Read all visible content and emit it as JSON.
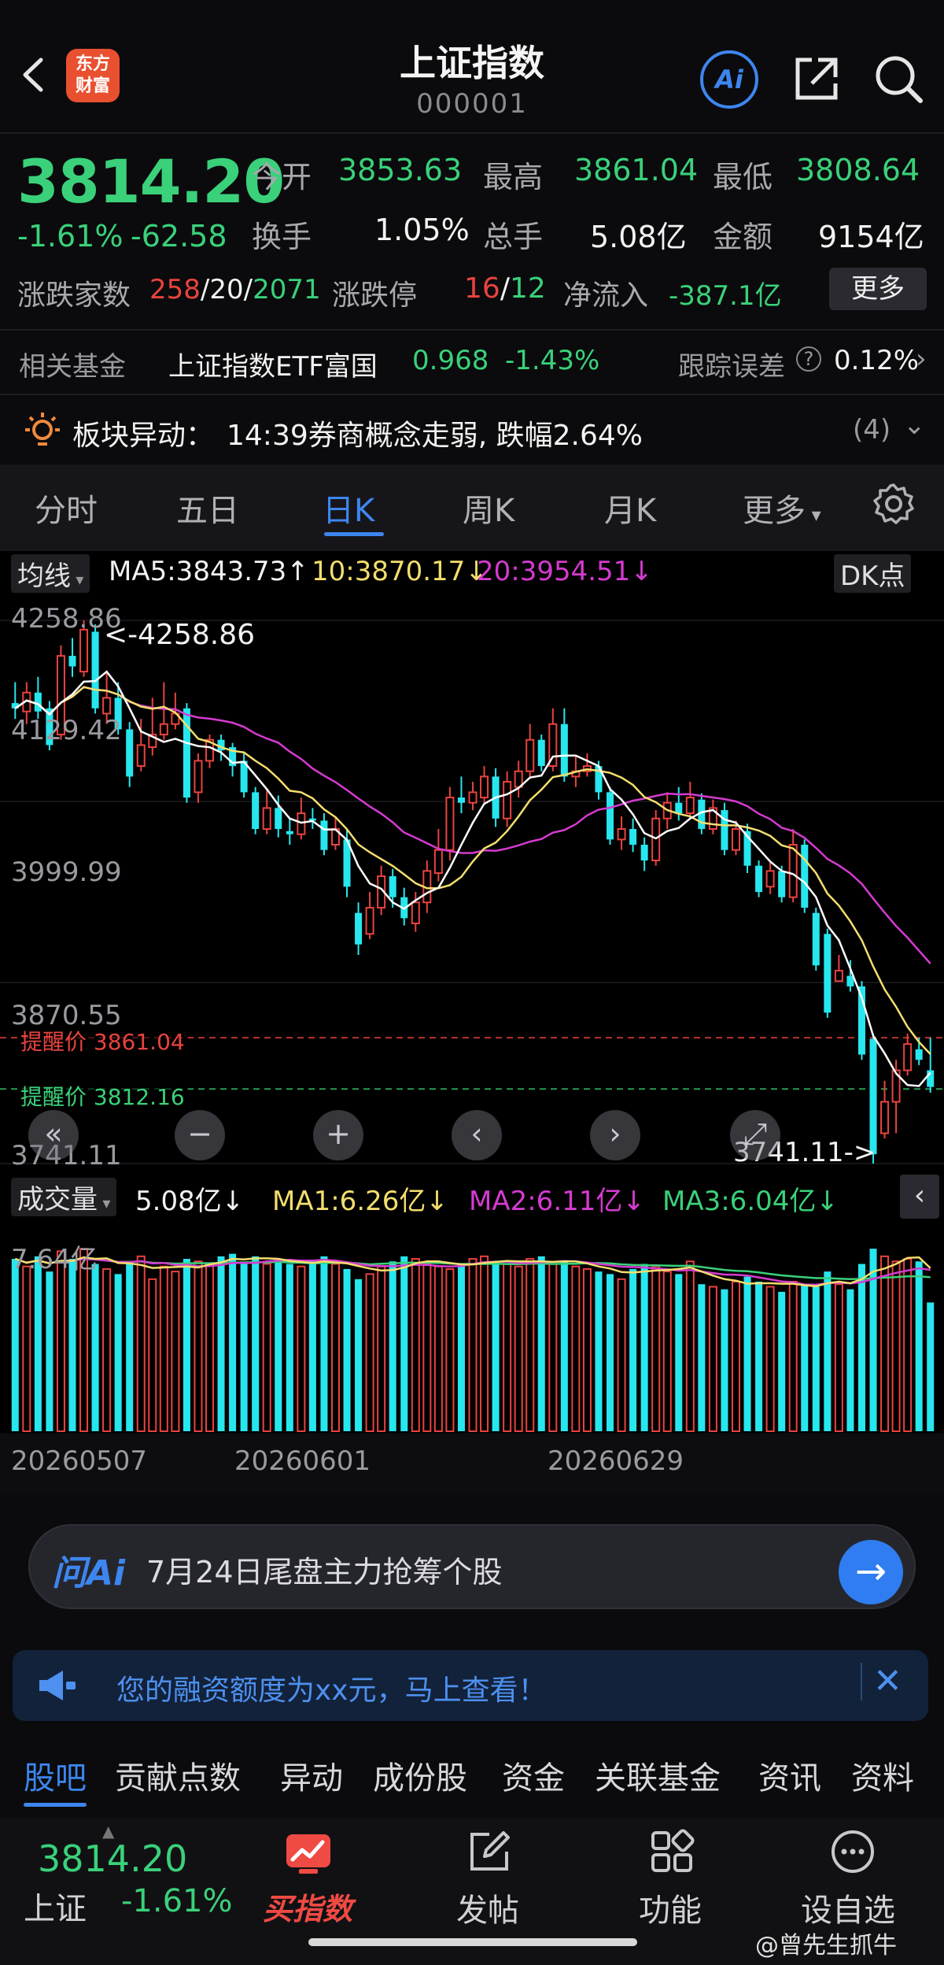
{
  "header": {
    "title": "上证指数",
    "code": "000001",
    "logo_text_1": "东方",
    "logo_text_2": "财富",
    "ai_label": "Ai"
  },
  "quote": {
    "price": "3814.20",
    "change_pct": "-1.61%",
    "change_abs": "-62.58",
    "open_label": "今开",
    "open": "3853.63",
    "high_label": "最高",
    "high": "3861.04",
    "low_label": "最低",
    "low": "3808.64",
    "turnover_label": "换手",
    "turnover": "1.05%",
    "volume_label": "总手",
    "volume": "5.08亿",
    "amount_label": "金额",
    "amount": "9154亿",
    "breadth_label": "涨跌家数",
    "up_count": "258",
    "flat_count": "20",
    "down_count": "2071",
    "limit_label": "涨跌停",
    "limit_up": "16",
    "limit_down": "12",
    "inflow_label": "净流入",
    "inflow": "-387.1亿",
    "more_label": "更多"
  },
  "fund": {
    "label": "相关基金",
    "name": "上证指数ETF富国",
    "price": "0.968",
    "change": "-1.43%",
    "tracking_label": "跟踪误差",
    "tracking_value": "0.12%"
  },
  "alert": {
    "label": "板块异动",
    "text": "14:39券商概念走弱, 跌幅2.64%",
    "count": "(4)"
  },
  "period_tabs": [
    "分时",
    "五日",
    "日K",
    "周K",
    "月K",
    "更多"
  ],
  "chart_header": {
    "indicator": "均线",
    "ma5": "MA5:3843.73",
    "ma10": "10:3870.17",
    "ma20": "20:3954.51",
    "dk_label": "DK点"
  },
  "price_axis": [
    "4258.86",
    "4129.42",
    "3999.99",
    "3870.55",
    "3741.11"
  ],
  "chart_annotations": {
    "max_label": "<-4258.86",
    "min_label": "3741.11->",
    "alert_red_label": "提醒价",
    "alert_red_value": "3861.04",
    "alert_green_label": "提醒价",
    "alert_green_value": "3812.16"
  },
  "volume_header": {
    "indicator": "成交量",
    "vol": "5.08亿",
    "ma1": "MA1:6.26亿",
    "ma2": "MA2:6.11亿",
    "ma3": "MA3:6.04亿",
    "axis_top": "7.64亿"
  },
  "date_axis": [
    "20260507",
    "20260601",
    "20260629"
  ],
  "ask": {
    "logo": "问Ai",
    "text": "7月24日尾盘主力抢筹个股"
  },
  "promo": {
    "text": "您的融资额度为xx元，马上查看！"
  },
  "bottom_tabs": [
    "股吧",
    "贡献点数",
    "异动",
    "成份股",
    "资金",
    "关联基金",
    "资讯",
    "资料"
  ],
  "bottom_bar": {
    "price": "3814.20",
    "name": "上证",
    "change": "-1.61%",
    "buy_label": "买指数",
    "post_label": "发帖",
    "func_label": "功能",
    "watch_label": "设自选"
  },
  "watermark": "@曾先生抓牛",
  "colors": {
    "up": "#e8433f",
    "down": "#27e6ee",
    "accent": "#3d86f0",
    "ma5": "#ffffff",
    "ma10": "#f3de6d",
    "ma20": "#d53bd0"
  },
  "chart_data": {
    "type": "candlestick",
    "price_range": [
      3741.11,
      4258.86
    ],
    "candles": [
      [
        4180,
        4175,
        4200,
        4165
      ],
      [
        4172,
        4190,
        4200,
        4160
      ],
      [
        4190,
        4172,
        4205,
        4165
      ],
      [
        4175,
        4140,
        4182,
        4135
      ],
      [
        4150,
        4225,
        4235,
        4145
      ],
      [
        4225,
        4215,
        4242,
        4205
      ],
      [
        4210,
        4250,
        4258.86,
        4205
      ],
      [
        4248,
        4175,
        4255,
        4170
      ],
      [
        4170,
        4185,
        4210,
        4160
      ],
      [
        4185,
        4155,
        4200,
        4150
      ],
      [
        4155,
        4110,
        4162,
        4100
      ],
      [
        4120,
        4140,
        4165,
        4115
      ],
      [
        4138,
        4150,
        4185,
        4130
      ],
      [
        4150,
        4160,
        4200,
        4145
      ],
      [
        4160,
        4170,
        4190,
        4155
      ],
      [
        4175,
        4090,
        4180,
        4085
      ],
      [
        4095,
        4125,
        4132,
        4085
      ],
      [
        4125,
        4145,
        4150,
        4118
      ],
      [
        4145,
        4135,
        4150,
        4125
      ],
      [
        4138,
        4120,
        4142,
        4110
      ],
      [
        4125,
        4095,
        4132,
        4090
      ],
      [
        4095,
        4060,
        4100,
        4055
      ],
      [
        4060,
        4080,
        4098,
        4055
      ],
      [
        4080,
        4060,
        4092,
        4052
      ],
      [
        4058,
        4055,
        4070,
        4045
      ],
      [
        4055,
        4075,
        4090,
        4050
      ],
      [
        4070,
        4068,
        4080,
        4060
      ],
      [
        4068,
        4040,
        4075,
        4035
      ],
      [
        4045,
        4060,
        4072,
        4040
      ],
      [
        4050,
        4005,
        4060,
        3995
      ],
      [
        3980,
        3950,
        3990,
        3940
      ],
      [
        3960,
        3985,
        4000,
        3955
      ],
      [
        3985,
        4015,
        4025,
        3978
      ],
      [
        4015,
        3995,
        4022,
        3985
      ],
      [
        3995,
        3975,
        4004,
        3968
      ],
      [
        3970,
        3990,
        4000,
        3962
      ],
      [
        3990,
        4020,
        4030,
        3980
      ],
      [
        4018,
        4040,
        4060,
        4010
      ],
      [
        4040,
        4090,
        4100,
        4030
      ],
      [
        4090,
        4085,
        4110,
        4075
      ],
      [
        4085,
        4095,
        4105,
        4078
      ],
      [
        4090,
        4110,
        4120,
        4085
      ],
      [
        4110,
        4070,
        4118,
        4062
      ],
      [
        4070,
        4105,
        4115,
        4062
      ],
      [
        4100,
        4115,
        4125,
        4090
      ],
      [
        4115,
        4145,
        4160,
        4108
      ],
      [
        4145,
        4120,
        4150,
        4115
      ],
      [
        4120,
        4160,
        4175,
        4115
      ],
      [
        4160,
        4110,
        4175,
        4105
      ],
      [
        4110,
        4115,
        4130,
        4100
      ],
      [
        4115,
        4120,
        4132,
        4110
      ],
      [
        4120,
        4095,
        4125,
        4088
      ],
      [
        4095,
        4050,
        4100,
        4045
      ],
      [
        4050,
        4060,
        4072,
        4040
      ],
      [
        4060,
        4045,
        4070,
        4038
      ],
      [
        4045,
        4030,
        4052,
        4020
      ],
      [
        4030,
        4070,
        4078,
        4025
      ],
      [
        4070,
        4085,
        4095,
        4060
      ],
      [
        4085,
        4075,
        4100,
        4068
      ],
      [
        4075,
        4090,
        4105,
        4070
      ],
      [
        4088,
        4060,
        4094,
        4055
      ],
      [
        4060,
        4080,
        4088,
        4055
      ],
      [
        4078,
        4040,
        4085,
        4035
      ],
      [
        4040,
        4060,
        4068,
        4035
      ],
      [
        4058,
        4025,
        4065,
        4018
      ],
      [
        4025,
        4000,
        4030,
        3995
      ],
      [
        4005,
        4020,
        4028,
        3998
      ],
      [
        4020,
        3995,
        4025,
        3990
      ],
      [
        3995,
        4045,
        4060,
        3990
      ],
      [
        4045,
        3985,
        4050,
        3980
      ],
      [
        3980,
        3930,
        3985,
        3925
      ],
      [
        3960,
        3885,
        3965,
        3880
      ],
      [
        3915,
        3925,
        3940,
        3915
      ],
      [
        3920,
        3910,
        3935,
        3905
      ],
      [
        3910,
        3845,
        3915,
        3840
      ],
      [
        3860,
        3750,
        3865,
        3741.11
      ],
      [
        3770,
        3800,
        3820,
        3765
      ],
      [
        3800,
        3830,
        3840,
        3770
      ],
      [
        3830,
        3855,
        3865,
        3825
      ],
      [
        3850,
        3840,
        3861,
        3835
      ],
      [
        3830,
        3814.2,
        3861.04,
        3808.64
      ]
    ],
    "volume": {
      "axis_max": "7.64亿",
      "values": [
        6.8,
        6.5,
        6.9,
        6.3,
        7.1,
        6.8,
        7.2,
        6.6,
        6.4,
        6.2,
        6.7,
        6.9,
        6.0,
        6.5,
        6.3,
        6.8,
        6.7,
        6.6,
        6.9,
        7.0,
        6.7,
        6.9,
        6.6,
        6.8,
        6.6,
        6.5,
        6.7,
        6.9,
        6.6,
        6.4,
        6.0,
        6.2,
        6.5,
        6.7,
        6.9,
        6.8,
        6.6,
        6.5,
        6.4,
        6.6,
        6.8,
        6.9,
        6.7,
        6.6,
        6.5,
        6.8,
        6.9,
        6.6,
        6.7,
        6.5,
        6.4,
        6.3,
        6.2,
        6.0,
        6.4,
        6.6,
        6.5,
        6.3,
        6.2,
        6.7,
        5.8,
        5.7,
        5.6,
        5.9,
        6.1,
        5.9,
        5.7,
        5.5,
        5.9,
        5.8,
        5.7,
        6.3,
        5.8,
        5.6,
        6.6,
        7.2,
        6.9,
        6.7,
        6.8,
        6.7,
        5.08
      ]
    }
  }
}
